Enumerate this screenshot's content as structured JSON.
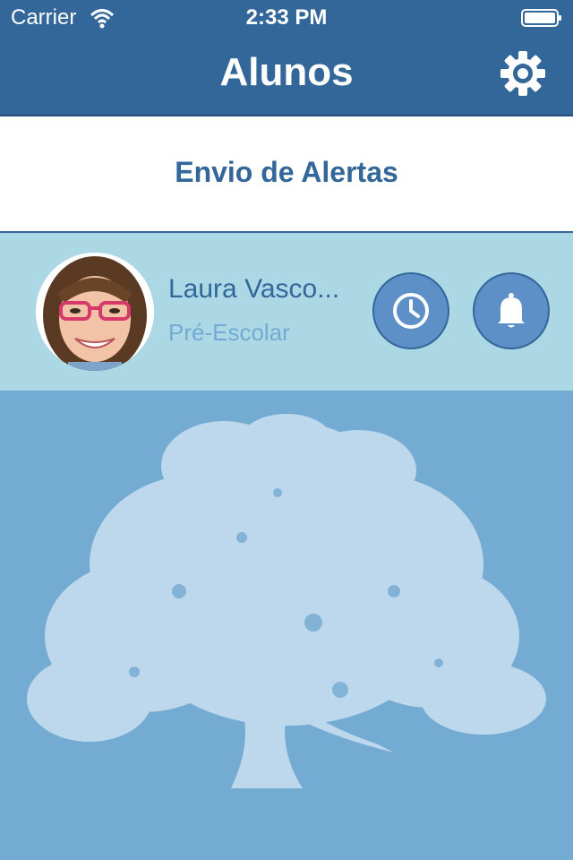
{
  "status_bar": {
    "carrier": "Carrier",
    "time": "2:33 PM"
  },
  "navbar": {
    "title": "Alunos",
    "settings_icon": "gear-icon"
  },
  "section": {
    "heading": "Envio de Alertas"
  },
  "student": {
    "name": "Laura Vasco...",
    "class": "Pré-Escolar",
    "actions": [
      {
        "icon": "clock-icon"
      },
      {
        "icon": "bell-icon"
      }
    ]
  },
  "colors": {
    "nav": "#336699",
    "row": "#acd8e5",
    "background": "#74abd2",
    "button": "#5c90c6",
    "watermark": "#bdd8ec"
  }
}
